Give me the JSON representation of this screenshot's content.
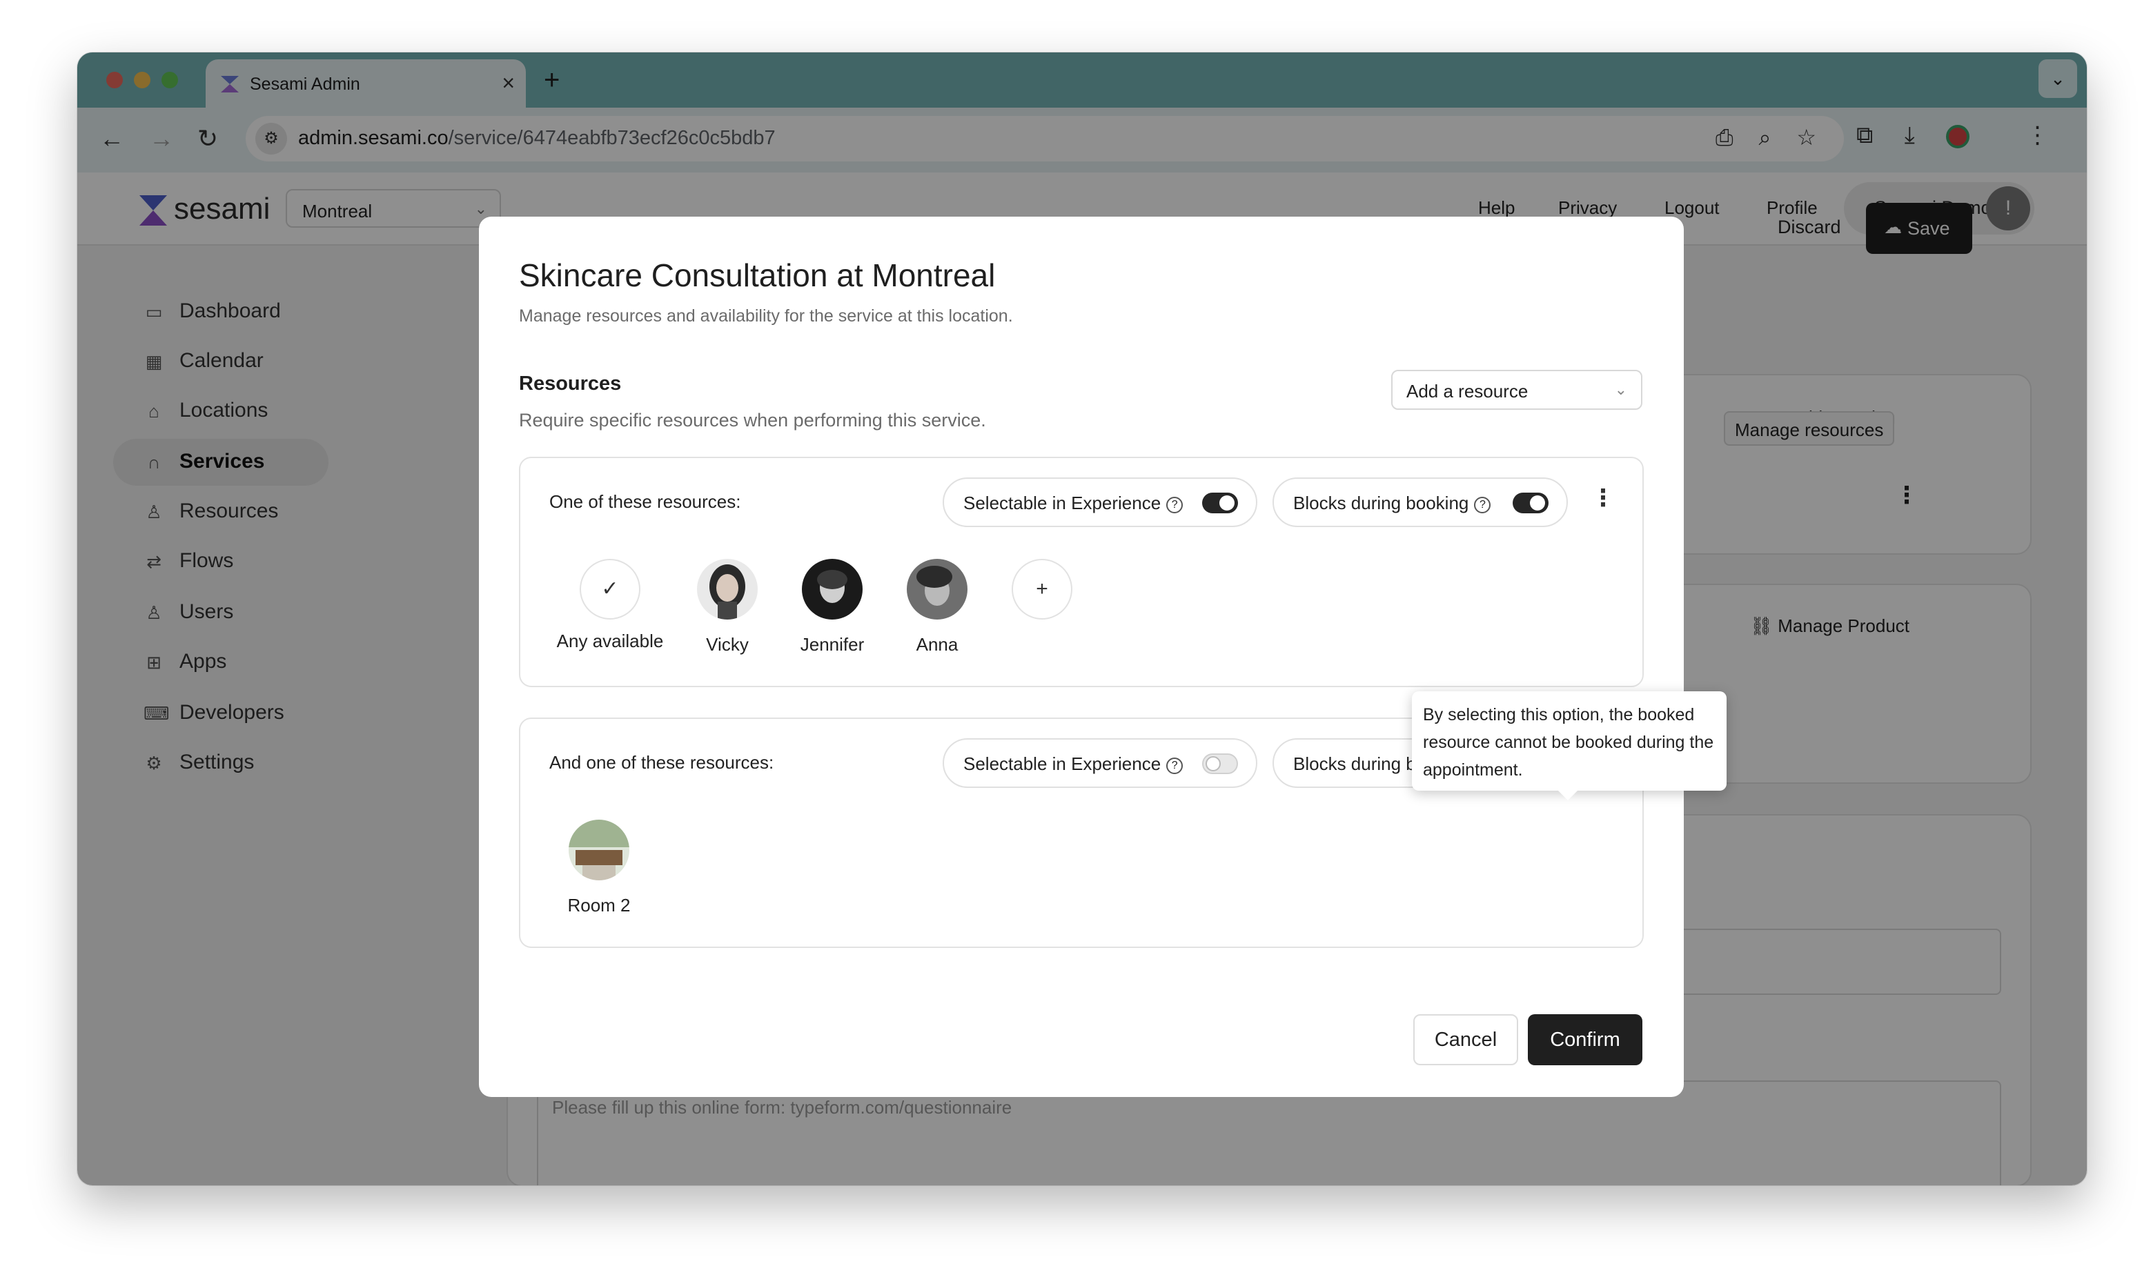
{
  "browser": {
    "tab_title": "Sesami Admin",
    "url_domain": "admin.sesami.co",
    "url_path": "/service/6474eabfb73ecf26c0c5bdb7",
    "traffic_colors": [
      "#ec6a5e",
      "#f4bf4f",
      "#61c554"
    ]
  },
  "header": {
    "logo_text": "sesami",
    "location_select": "Montreal",
    "nav": [
      "Help",
      "Privacy",
      "Logout",
      "Profile"
    ],
    "user_name": "Sesami Demo",
    "user_badge": "!"
  },
  "sidebar": {
    "items": [
      {
        "label": "Dashboard",
        "icon": "monitor-icon",
        "glyph": "▭"
      },
      {
        "label": "Calendar",
        "icon": "calendar-icon",
        "glyph": "▦"
      },
      {
        "label": "Locations",
        "icon": "store-icon",
        "glyph": "⌂"
      },
      {
        "label": "Services",
        "icon": "headphones-icon",
        "glyph": "∩",
        "active": true
      },
      {
        "label": "Resources",
        "icon": "person-icon",
        "glyph": "♙"
      },
      {
        "label": "Flows",
        "icon": "flow-icon",
        "glyph": "⇄"
      },
      {
        "label": "Users",
        "icon": "users-icon",
        "glyph": "♙"
      },
      {
        "label": "Apps",
        "icon": "apps-icon",
        "glyph": "⊞"
      },
      {
        "label": "Developers",
        "icon": "terminal-icon",
        "glyph": "⌨"
      },
      {
        "label": "Settings",
        "icon": "gear-icon",
        "glyph": "⚙"
      }
    ]
  },
  "page": {
    "discard_label": "Discard",
    "save_label": "Save",
    "add_location_label": "Add Location",
    "manage_resources_label": "Manage resources",
    "manage_product_label": "Manage Product",
    "placeholder_text": "Please fill up this online form: typeform.com/questionnaire"
  },
  "modal": {
    "title": "Skincare Consultation at Montreal",
    "subtitle": "Manage resources and availability for the service at this location.",
    "resources_heading": "Resources",
    "resources_sub": "Require specific resources when performing this service.",
    "add_resource_placeholder": "Add a resource",
    "groups": [
      {
        "label": "One of these resources:",
        "selectable_label": "Selectable in Experience",
        "selectable_on": true,
        "blocks_label": "Blocks during booking",
        "blocks_on": true,
        "resources": [
          "Any available",
          "Vicky",
          "Jennifer",
          "Anna"
        ]
      },
      {
        "label": "And one of these resources:",
        "selectable_label": "Selectable in Experience",
        "selectable_on": false,
        "blocks_label": "Blocks during booking",
        "blocks_on": true,
        "resources": [
          "Room 2"
        ]
      }
    ],
    "tooltip": "By selecting this option, the booked resource cannot be booked during the appointment.",
    "cancel_label": "Cancel",
    "confirm_label": "Confirm"
  }
}
